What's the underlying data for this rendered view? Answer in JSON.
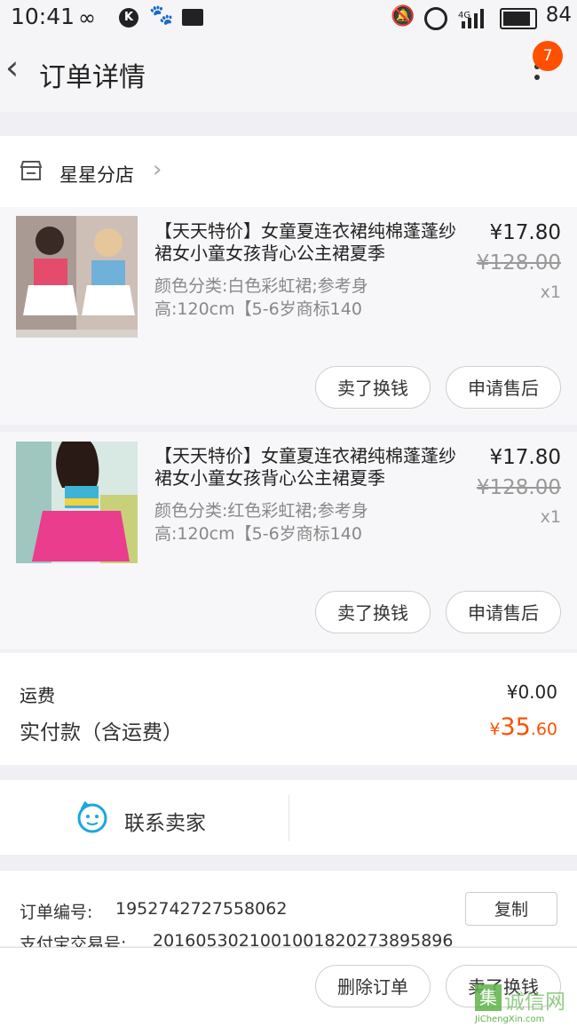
{
  "status": {
    "time": "10:41",
    "battery": "84",
    "signal": "4G"
  },
  "nav": {
    "title": "订单详情",
    "badge": "7"
  },
  "shop": {
    "name": "星星分店"
  },
  "items": [
    {
      "title": "【天天特价】女童夏连衣裙纯棉蓬蓬纱裙女小童女孩背心公主裙夏季",
      "sku": "颜色分类:白色彩虹裙;参考身高:120cm【5-6岁商标140",
      "price": "¥17.80",
      "original_price": "¥128.00",
      "qty": "x1",
      "btn_sell": "卖了换钱",
      "btn_service": "申请售后"
    },
    {
      "title": "【天天特价】女童夏连衣裙纯棉蓬蓬纱裙女小童女孩背心公主裙夏季",
      "sku": "颜色分类:红色彩虹裙;参考身高:120cm【5-6岁商标140",
      "price": "¥17.80",
      "original_price": "¥128.00",
      "qty": "x1",
      "btn_sell": "卖了换钱",
      "btn_service": "申请售后"
    }
  ],
  "summary": {
    "shipping_label": "运费",
    "shipping_value": "¥0.00",
    "paid_label": "实付款（含运费）",
    "paid_currency": "¥",
    "paid_int": "35",
    "paid_dec": ".60"
  },
  "contact": {
    "label": "联系卖家"
  },
  "order_info": {
    "order_no_label": "订单编号:",
    "order_no": "1952742727558062",
    "copy": "复制",
    "alipay_label": "支付宝交易号:",
    "alipay_no": "2016053021001001820273895896"
  },
  "bottom": {
    "delete": "删除订单",
    "sell": "卖了换钱"
  },
  "watermark": {
    "cn": "诚信网",
    "en": "JiChengXin.com"
  },
  "colors": {
    "accent": "#ff5000",
    "contact_icon": "#1aa7e0"
  },
  "icons": [
    "back-arrow-icon",
    "more-icon",
    "shop-icon",
    "chevron-right-icon",
    "contact-seller-icon"
  ]
}
